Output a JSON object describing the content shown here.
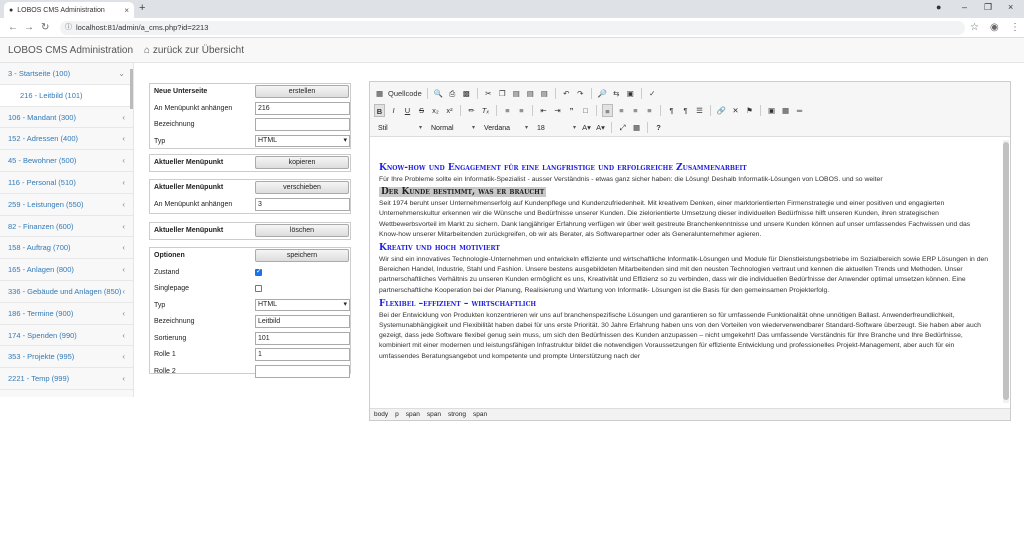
{
  "browser": {
    "tab_title": "LOBOS CMS Administration",
    "url": "localhost:81/admin/a_cms.php?id=2213"
  },
  "app": {
    "brand": "LOBOS CMS Administration",
    "back_link": "zurück zur Übersicht"
  },
  "sidebar": {
    "items": [
      {
        "label": "3 - Startseite (100)",
        "chevron": "⌄"
      },
      {
        "label": "216 - Leitbild (101)",
        "chevron": ""
      },
      {
        "label": "106 - Mandant (300)",
        "chevron": "‹"
      },
      {
        "label": "152 - Adressen (400)",
        "chevron": "‹"
      },
      {
        "label": "45 - Bewohner (500)",
        "chevron": "‹"
      },
      {
        "label": "116 - Personal (510)",
        "chevron": "‹"
      },
      {
        "label": "259 - Leistungen (550)",
        "chevron": "‹"
      },
      {
        "label": "82 - Finanzen (600)",
        "chevron": "‹"
      },
      {
        "label": "158 - Auftrag (700)",
        "chevron": "‹"
      },
      {
        "label": "165 - Anlagen (800)",
        "chevron": "‹"
      },
      {
        "label": "336 - Gebäude und Anlagen (850)",
        "chevron": "‹"
      },
      {
        "label": "186 - Termine (900)",
        "chevron": "‹"
      },
      {
        "label": "174 - Spenden (990)",
        "chevron": "‹"
      },
      {
        "label": "353 - Projekte (995)",
        "chevron": "‹"
      },
      {
        "label": "2221 - Temp (999)",
        "chevron": "‹"
      }
    ]
  },
  "new_page": {
    "title": "Neue Unterseite",
    "button": "erstellen",
    "attach_label": "An Menüpunkt anhängen",
    "attach_value": "216",
    "name_label": "Bezeichnung",
    "name_value": "",
    "type_label": "Typ",
    "type_value": "HTML"
  },
  "copy": {
    "title": "Aktueller Menüpunkt",
    "button": "kopieren"
  },
  "move": {
    "title": "Aktueller Menüpunkt",
    "button": "verschieben",
    "attach_label": "An Menüpunkt anhängen",
    "attach_value": "3"
  },
  "delete": {
    "title": "Aktueller Menüpunkt",
    "button": "löschen"
  },
  "options": {
    "title": "Optionen",
    "button": "speichern",
    "state_label": "Zustand",
    "state_checked": true,
    "single_label": "Singlepage",
    "single_checked": false,
    "type_label": "Typ",
    "type_value": "HTML",
    "name_label": "Bezeichnung",
    "name_value": "Leitbild",
    "sort_label": "Sortierung",
    "sort_value": "101",
    "role1_label": "Rolle 1",
    "role1_value": "1",
    "role2_label": "Rolle 2",
    "role2_value": ""
  },
  "toolbar": {
    "source": "Quellcode",
    "style": "Stil",
    "format": "Normal",
    "font": "Verdana",
    "size": "18"
  },
  "content": {
    "h1": "Know-how und Engagement für eine langfristige und erfolgreiche Zusammenarbeit",
    "p1": "Für Ihre Probleme sollte ein Informatik-Spezialist - ausser Verständnis - etwas ganz sicher haben: die Lösung! Deshalb Informatik-Lösungen von LOBOS. und so weiter",
    "h2": "Der Kunde bestimmt, was er braucht",
    "p2": "Seit 1974 beruht unser Unternehmenserfolg auf Kundenpflege und Kundenzufriedenheit. Mit kreativem Denken, einer marktorientierten Firmenstrategie und einer positiven und engagierten Unternehmenskultur erkennen wir die Wünsche und Bedürfnisse unserer Kunden. Die zielorientierte Umsetzung dieser individuellen Bedürfnisse hilft unseren Kunden, ihren strategischen Wettbewerbsvorteil im Markt zu sichern. Dank langjähriger Erfahrung verfügen wir über weit gestreute Branchenkenntnisse und unsere Kunden können auf unser umfassendes Fachwissen und das Know-how unserer Mitarbeitenden zurückgreifen, ob wir als Berater, als Softwarepartner oder als Generalunternehmer agieren.",
    "h3": "Kreativ und hoch motiviert",
    "p3": "Wir sind ein innovatives Technologie-Unternehmen und entwickeln effiziente und wirtschaftliche Informatik-Lösungen und Module für Dienstleistungsbetriebe im Sozialbereich sowie ERP Lösungen in den Bereichen Handel, Industrie, Stahl und Fashion. Unsere bestens ausgebildeten Mitarbeitenden sind mit den neusten Technologien vertraut und kennen die aktuellen Trends und Methoden. Unser partnerschaftliches Verhältnis zu unseren Kunden ermöglicht es uns, Kreativität und Effizienz so zu verbinden, dass wir die individuellen Bedürfnisse der Anwender optimal umsetzen können. Eine partnerschaftliche Kooperation bei der Planung, Realisierung und Wartung von Informatik- Lösungen ist die Basis für den gemeinsamen Projekterfolg.",
    "h4": "Flexibel –effizient – wirtschaftlich",
    "p4": "Bei der Entwicklung von Produkten konzentrieren wir uns auf branchenspezifische Lösungen und garantieren so für umfassende Funktionalität ohne unnötigen Ballast. Anwenderfreundlichkeit, Systemunabhängigkeit und Flexibilität haben dabei für uns erste Priorität. 30 Jahre Erfahrung haben uns von den Vorteilen von wiederverwendbarer Standard-Software überzeugt. Sie haben aber auch gezeigt, dass jede Software flexibel genug sein muss, um sich den Bedürfnissen des Kunden anzupassen – nicht umgekehrt! Das umfassende Verständnis für Ihre Branche und Ihre Bedürfnisse, kombiniert mit einer modernen und leistungsfähigen Infrastruktur bildet die notwendigen Voraussetzungen für effiziente Entwicklung und professionelles Projekt-Management, aber auch für ein umfassendes Beratungsangebot und kompetente und prompte Unterstützung nach der"
  },
  "statusbar": [
    "body",
    "p",
    "span",
    "span",
    "strong",
    "span"
  ]
}
